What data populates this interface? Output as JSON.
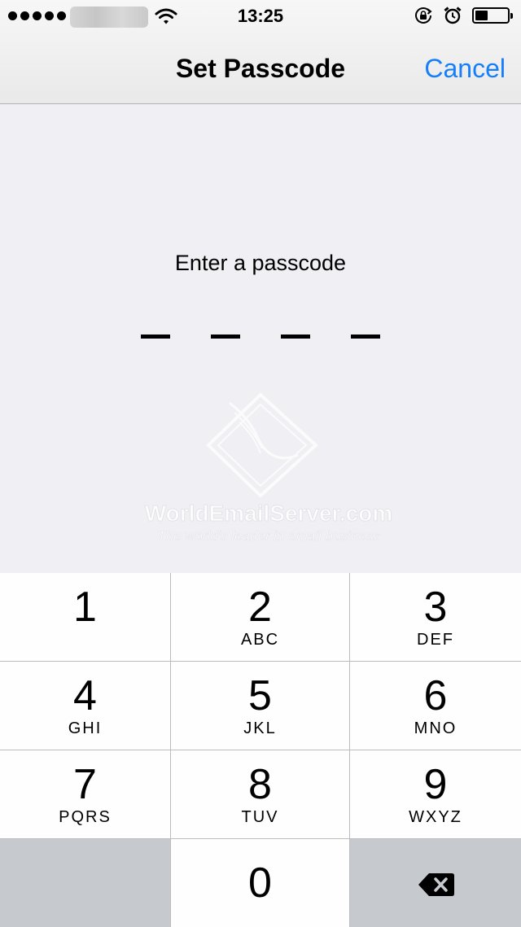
{
  "status_bar": {
    "time": "13:25",
    "signal_icon": "signal-dots-icon",
    "wifi_icon": "wifi-icon",
    "rotation_lock_icon": "rotation-lock-icon",
    "alarm_icon": "alarm-icon",
    "battery_icon": "battery-icon",
    "battery_level": 0.4
  },
  "nav": {
    "title": "Set Passcode",
    "cancel_label": "Cancel"
  },
  "prompt": "Enter a passcode",
  "passcode": {
    "length": 4,
    "entered": 0
  },
  "watermark": {
    "brand": "WorldEmailServer.com",
    "tagline": "The world's leader in email business"
  },
  "keypad": {
    "keys": [
      {
        "digit": "1",
        "letters": ""
      },
      {
        "digit": "2",
        "letters": "ABC"
      },
      {
        "digit": "3",
        "letters": "DEF"
      },
      {
        "digit": "4",
        "letters": "GHI"
      },
      {
        "digit": "5",
        "letters": "JKL"
      },
      {
        "digit": "6",
        "letters": "MNO"
      },
      {
        "digit": "7",
        "letters": "PQRS"
      },
      {
        "digit": "8",
        "letters": "TUV"
      },
      {
        "digit": "9",
        "letters": "WXYZ"
      }
    ],
    "zero": {
      "digit": "0"
    },
    "delete_icon": "delete-backspace-icon"
  },
  "colors": {
    "accent": "#157efb",
    "background": "#efeff4",
    "key_background": "#fefefe",
    "function_key_background": "#c6c9cd"
  }
}
